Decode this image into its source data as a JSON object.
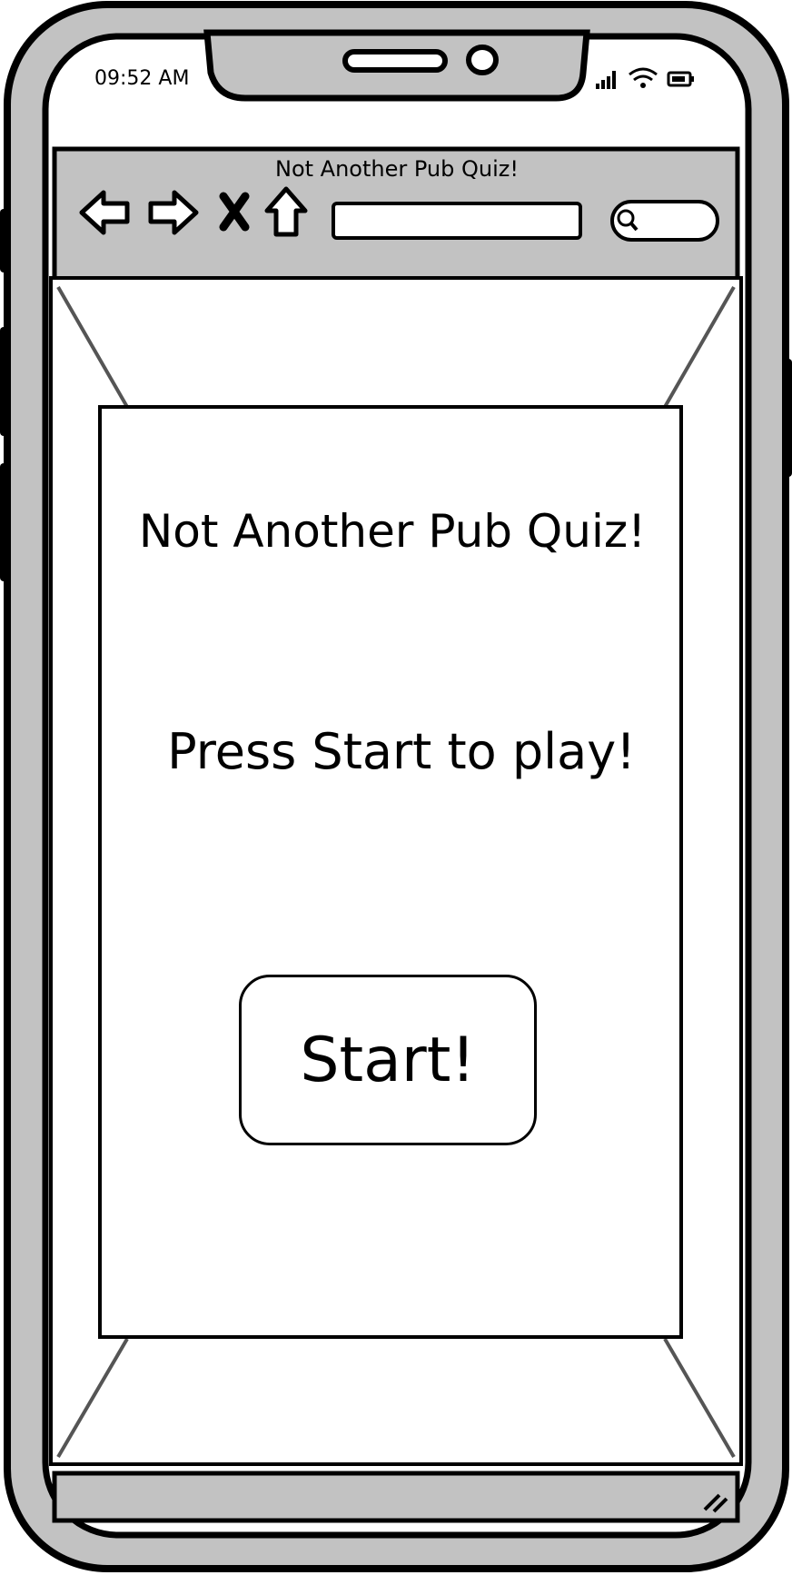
{
  "status_bar": {
    "time": "09:52 AM"
  },
  "browser": {
    "title": "Not Another Pub Quiz!",
    "url_value": "",
    "search_value": ""
  },
  "page": {
    "title": "Not Another Pub Quiz!",
    "prompt": "Press Start to play!",
    "start_label": "Start!"
  },
  "colors": {
    "device_frame": "#c2c2c2",
    "browser_bar": "#c2c2c2",
    "outline": "#000000",
    "page": "#ffffff"
  }
}
